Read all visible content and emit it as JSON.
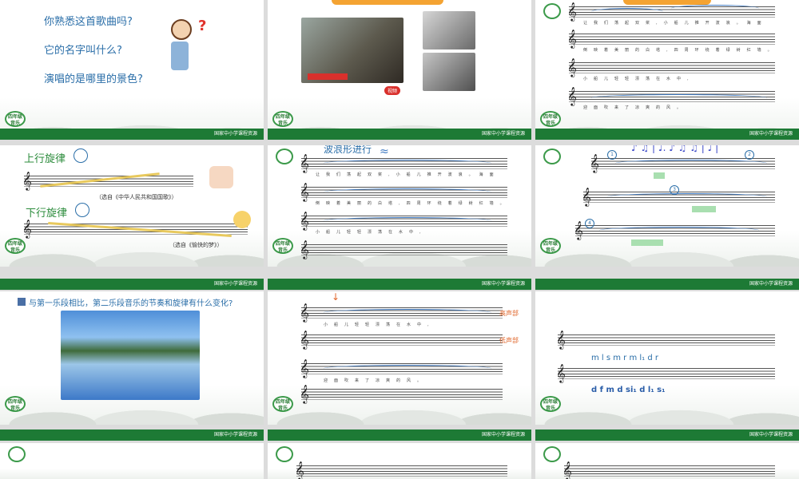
{
  "footer_text": "国家中小学课程资源",
  "badge_text": "四年级音乐",
  "slides": {
    "s1": {
      "q1": "你熟悉这首歌曲吗?",
      "q2": "它的名字叫什么?",
      "q3": "演唱的是哪里的景色?",
      "mark": "?"
    },
    "s2": {
      "tag": "视频"
    },
    "s3": {
      "lyr1": "让我们荡起双桨,小船儿推开波浪。海面",
      "lyr2": "倒映着美丽的白塔,四周环绕着绿树红墙。",
      "lyr3": "小船儿轻轻漂荡在水中,",
      "lyr4": "迎面吹来了凉爽的风。"
    },
    "s4": {
      "up": "上行旋律",
      "up_src": "（选自《中华人民共和国国歌》）",
      "down": "下行旋律",
      "down_src": "（选自《愉快的梦》）"
    },
    "s5": {
      "title": "波浪形进行"
    },
    "s6": {
      "n1": "1",
      "n2": "2",
      "n3": "3",
      "n4": "4"
    },
    "s7": {
      "q": "与第一乐段相比，第二乐段音乐的节奏和旋律有什么变化?"
    },
    "s8": {
      "hi": "高声部",
      "lo": "低声部"
    },
    "s9": {
      "top": "m    l    s m r    m    l₁ d r",
      "bot": "d    f    m d   si₁   d   l₁  s₁"
    }
  }
}
